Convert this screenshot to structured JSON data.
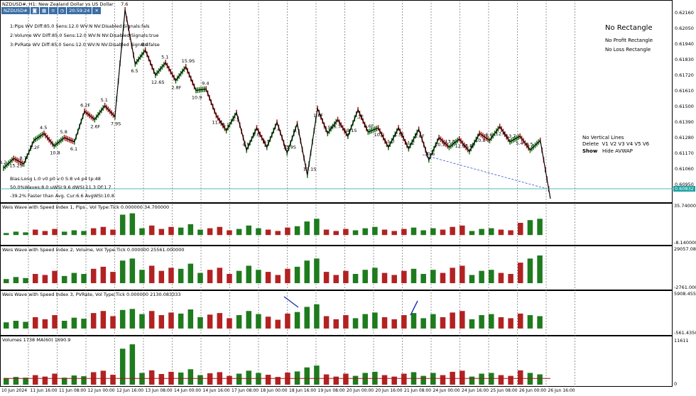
{
  "title": "NZDUSD#, H1:  New Zealand Dollar vs US Dollar",
  "toolbar": {
    "symbol": "NZDUSD#",
    "time": "20:59:24"
  },
  "info_lines": [
    "1:Pips   WV Diff:85.0 Sens:12.0 WV:N NV:Disabled Signals:fals",
    "2:Volume WV Diff:85.0 Sens:12.0 WV:N NV:Disabled Signals:true",
    "3:PVRate WV Diff:85.0 Sens:12.0 WV:N NV:Disabled Signals:false"
  ],
  "stats_lines": [
    "Bias:Long L:0 v0 p0 v:0 S:8 v4 p4 tp:48",
    "50.0%Waves:8.0 uWSI:9.6 dWSI:11.3 Df:1.7",
    "-39.2% Faster than Avg. Cur:6.6 AvgWSI:10.8"
  ],
  "right_panel": {
    "title": "No Rectangle",
    "line1": "No Profit Rectangle",
    "line2": "No Loss Rectangle",
    "vlines": "No Vertical Lines",
    "delete_label": "Delete",
    "v_buttons": [
      "V1",
      "V2",
      "V3",
      "V4",
      "V5",
      "V6"
    ],
    "show_label": "Show",
    "hide_label": "Hide AVWAP"
  },
  "current_price": "0.60832",
  "price_axis": [
    "0.62160",
    "0.62050",
    "0.61940",
    "0.61830",
    "0.61720",
    "0.61610",
    "0.61500",
    "0.61390",
    "0.61280",
    "0.61170",
    "0.61060",
    "0.60950"
  ],
  "indicator1": {
    "label": "Weis Wave with Speed Index 1, Pips   , Vol Type:Tick 0.000000 34.700000",
    "top": "35.740000",
    "bottom": "-8.140000"
  },
  "indicator2": {
    "label": "Weis Wave with Speed Index 2, Volume, Vol Type:Tick 0.000000 25561.000000",
    "top": "29057.0800",
    "bottom": "-2761.0000"
  },
  "indicator3": {
    "label": "Weis Wave with Speed Index 3, PVRate, Vol Type:Tick 0.000000 2130.083333",
    "top": "5908.45500",
    "bottom": "-561.43500"
  },
  "volumes": {
    "label": "Volumes 1738 MA(60) 1690.9",
    "top": "11611",
    "bottom": "0"
  },
  "x_labels": [
    "10 Jun 2024",
    "11 Jun 16:00",
    "11 Jun 08:00",
    "12 Jun 00:00",
    "12 Jun 16:00",
    "13 Jun 08:00",
    "14 Jun 00:00",
    "14 Jun 16:00",
    "17 Jun 08:00",
    "18 Jun 00:00",
    "18 Jun 16:00",
    "19 Jun 08:00",
    "20 Jun 00:00",
    "20 Jun 16:00",
    "21 Jun 08:00",
    "24 Jun 00:00",
    "24 Jun 16:00",
    "25 Jun 08:00",
    "26 Jun 00:00",
    "26 Jun 16:00"
  ],
  "wave_labels": [
    "8.2",
    "15.2S",
    "8.7",
    "2.2F",
    "4.5",
    "10.8",
    "5.8",
    "6.1",
    "6.2F",
    "2.6F",
    "5.1",
    "7.9S",
    "7.6",
    "6.5",
    "6.4",
    "12.6S",
    "5.1",
    "2.8F",
    "15.9S",
    "10.9",
    "9.4",
    "11.8",
    "8.1",
    "5.5",
    "4.9",
    "5.0",
    "8.5",
    "7.4",
    "13.9S",
    "8.1",
    "17.1S",
    "1.6F",
    "3.5F",
    "6.7",
    "19.1S",
    "7.2F",
    "6.6F",
    "10.9",
    "11.0",
    "1.5F",
    "11.2",
    "5.0F",
    "10.6",
    "10.3",
    "13.5",
    "12.8",
    "3.8F",
    "10.8",
    "6.6",
    "12.6",
    "13.7",
    "5.4",
    "9.5"
  ],
  "colors": {
    "up": "#1e7b1e",
    "down": "#b22222",
    "signal": "#cc33cc",
    "wave": "#000000",
    "ma": "#aa1111",
    "price_line": "#1aa0a0"
  },
  "chart_data": [
    {
      "type": "line",
      "name": "price waves",
      "title": "NZDUSD#, H1:  New Zealand Dollar vs US Dollar",
      "ylim": [
        0.6083,
        0.6221
      ],
      "x": [
        0,
        1,
        2,
        3,
        4,
        5,
        6,
        7,
        8,
        9,
        10,
        11,
        12,
        13,
        14,
        15,
        16,
        17,
        18,
        19,
        20,
        21,
        22,
        23,
        24,
        25,
        26,
        27,
        28,
        29,
        30,
        31,
        32,
        33,
        34,
        35,
        36,
        37,
        38,
        39,
        40,
        41,
        42,
        43,
        44,
        45,
        46,
        47,
        48,
        49,
        50,
        51,
        52,
        53,
        54
      ],
      "y": [
        0.6105,
        0.6112,
        0.6108,
        0.6125,
        0.613,
        0.6121,
        0.6127,
        0.6124,
        0.6146,
        0.614,
        0.615,
        0.6142,
        0.6219,
        0.618,
        0.619,
        0.6172,
        0.6181,
        0.6168,
        0.6178,
        0.6161,
        0.6162,
        0.6143,
        0.6132,
        0.6145,
        0.6118,
        0.6134,
        0.612,
        0.6138,
        0.6116,
        0.6137,
        0.61,
        0.6148,
        0.613,
        0.614,
        0.6128,
        0.6147,
        0.6131,
        0.6134,
        0.612,
        0.6134,
        0.6119,
        0.6133,
        0.6111,
        0.6127,
        0.612,
        0.6126,
        0.6117,
        0.613,
        0.6125,
        0.6135,
        0.6124,
        0.6128,
        0.6118,
        0.6125,
        0.6083
      ]
    },
    {
      "type": "bar",
      "name": "Weis Wave Pips",
      "ylim": [
        -8.14,
        35.74
      ],
      "values": [
        3,
        5,
        4,
        8,
        6,
        9,
        5,
        7,
        6,
        10,
        12,
        8,
        30,
        32,
        10,
        14,
        9,
        12,
        11,
        16,
        8,
        10,
        12,
        7,
        9,
        14,
        10,
        8,
        6,
        11,
        13,
        20,
        24,
        8,
        6,
        9,
        7,
        10,
        12,
        8,
        6,
        9,
        11,
        7,
        10,
        8,
        12,
        14,
        6,
        9,
        10,
        8,
        7,
        18,
        22,
        24
      ]
    },
    {
      "type": "bar",
      "name": "Weis Wave Volume",
      "ylim": [
        -2761,
        29057
      ],
      "values": [
        4000,
        6000,
        5000,
        9000,
        8000,
        12000,
        7000,
        10000,
        9000,
        14000,
        16000,
        11000,
        22000,
        24000,
        13000,
        17000,
        12000,
        15000,
        14000,
        19000,
        10000,
        13000,
        15000,
        9000,
        12000,
        17000,
        13000,
        11000,
        8000,
        14000,
        16000,
        22000,
        24000,
        11000,
        8000,
        12000,
        9000,
        13000,
        15000,
        10000,
        8000,
        12000,
        14000,
        9000,
        13000,
        10000,
        15000,
        17000,
        8000,
        12000,
        13000,
        10000,
        9000,
        20000,
        24000,
        27000
      ]
    },
    {
      "type": "bar",
      "name": "Weis Wave PVRate",
      "ylim": [
        -561.435,
        5908.455
      ],
      "values": [
        1200,
        1500,
        1300,
        2200,
        1800,
        2600,
        1500,
        2100,
        1900,
        3000,
        3400,
        2400,
        3600,
        3800,
        2800,
        3400,
        2600,
        3100,
        2900,
        3700,
        2200,
        2700,
        3000,
        2000,
        2600,
        3400,
        2800,
        2300,
        1700,
        2900,
        3200,
        4200,
        4700,
        2400,
        1800,
        2600,
        2000,
        2800,
        3100,
        2200,
        1800,
        2600,
        3000,
        2000,
        2800,
        2200,
        3100,
        3400,
        1800,
        2600,
        2800,
        2200,
        2000,
        2900,
        2600,
        2400
      ]
    },
    {
      "type": "bar",
      "name": "Volumes",
      "ylim": [
        0,
        11611
      ],
      "values": [
        1800,
        2100,
        1900,
        2600,
        2200,
        3000,
        1900,
        2500,
        2300,
        3400,
        3800,
        2700,
        9800,
        11000,
        3200,
        3900,
        2900,
        3500,
        3300,
        4200,
        2600,
        3100,
        3400,
        2400,
        3000,
        3800,
        3200,
        2700,
        2100,
        3300,
        3600,
        4700,
        5200,
        2800,
        2200,
        3000,
        2400,
        3200,
        3500,
        2600,
        2200,
        3000,
        3400,
        2400,
        3200,
        2600,
        3500,
        3800,
        2200,
        3000,
        3200,
        2600,
        2400,
        3900,
        3200,
        2800
      ],
      "ma": 1690.9
    }
  ]
}
